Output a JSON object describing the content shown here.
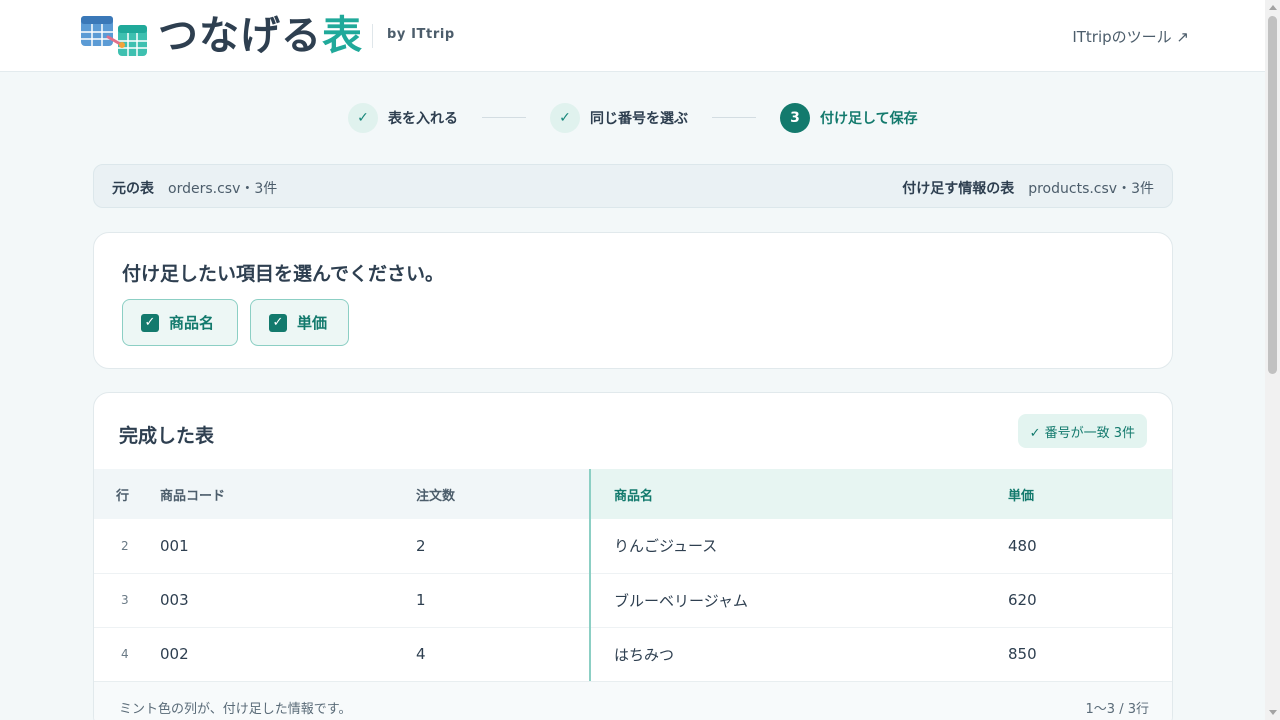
{
  "header": {
    "logo_main": "つなげる",
    "logo_accent": "表",
    "by": "by ITtrip",
    "tools_link": "ITtripのツール ↗"
  },
  "stepper": {
    "steps": [
      {
        "label": "表を入れる",
        "state": "done",
        "mark": "✓"
      },
      {
        "label": "同じ番号を選ぶ",
        "state": "done",
        "mark": "✓"
      },
      {
        "label": "付け足して保存",
        "state": "active",
        "mark": "3"
      }
    ]
  },
  "source": {
    "left_title": "元の表",
    "left_value": "orders.csv・3件",
    "right_title": "付け足す情報の表",
    "right_value": "products.csv・3件"
  },
  "select": {
    "title": "付け足したい項目を選んでください。",
    "chips": [
      {
        "label": "商品名",
        "checked": true,
        "mark": "✓"
      },
      {
        "label": "単価",
        "checked": true,
        "mark": "✓"
      }
    ]
  },
  "result": {
    "title": "完成した表",
    "badge": "✓ 番号が一致 3件",
    "columns": [
      "行",
      "商品コード",
      "注文数",
      "商品名",
      "単価"
    ],
    "rows": [
      [
        "2",
        "001",
        "2",
        "りんごジュース",
        "480"
      ],
      [
        "3",
        "003",
        "1",
        "ブルーベリージャム",
        "620"
      ],
      [
        "4",
        "002",
        "4",
        "はちみつ",
        "850"
      ]
    ],
    "footer_note": "ミント色の列が、付け足した情報です。",
    "footer_count": "1〜3 / 3行"
  },
  "colors": {
    "accent": "#137a6d",
    "mint": "#e7f5f2",
    "logo_accent": "#20a99a"
  },
  "icons": {
    "logo": "table-merge-icon",
    "check": "check-icon",
    "external": "external-link-icon"
  }
}
